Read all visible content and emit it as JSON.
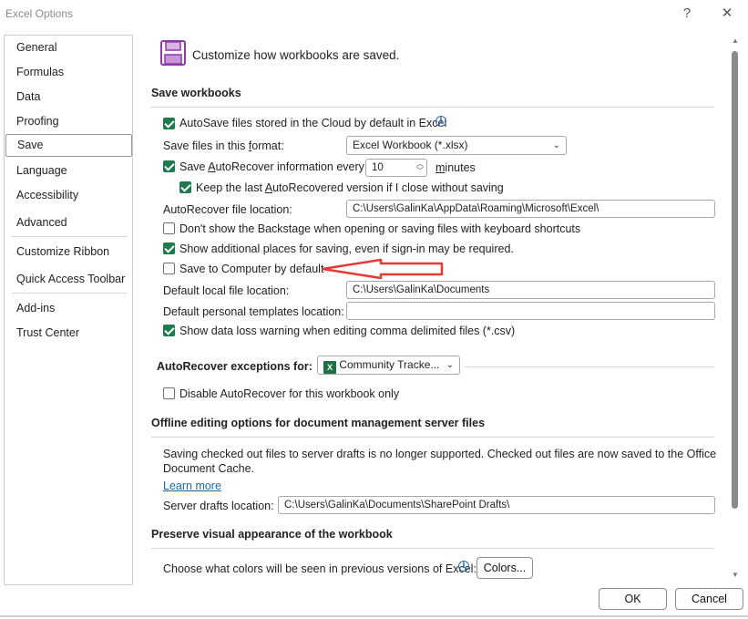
{
  "window": {
    "title": "Excel Options",
    "help_label": "?",
    "close_label": "✕"
  },
  "sidebar": {
    "items": [
      {
        "label": "General"
      },
      {
        "label": "Formulas"
      },
      {
        "label": "Data"
      },
      {
        "label": "Proofing"
      },
      {
        "label": "Save"
      },
      {
        "label": "Language"
      },
      {
        "label": "Accessibility"
      },
      {
        "label": "Advanced"
      },
      {
        "label": "Customize Ribbon"
      },
      {
        "label": "Quick Access Toolbar"
      },
      {
        "label": "Add-ins"
      },
      {
        "label": "Trust Center"
      }
    ],
    "selected": "Save"
  },
  "header": {
    "icon": "save-floppy-icon",
    "title": "Customize how workbooks are saved."
  },
  "save_workbooks": {
    "heading": "Save workbooks",
    "autosave_label": "AutoSave files stored in the Cloud by default in Excel",
    "autosave_checked": true,
    "format_label_pre": "Save files in this ",
    "format_label_u": "f",
    "format_label_post": "ormat:",
    "format_value": "Excel Workbook (*.xlsx)",
    "autorecover_pre": "Save ",
    "autorecover_u": "A",
    "autorecover_post": "utoRecover information every",
    "autorecover_checked": true,
    "autorecover_minutes": "10",
    "minutes_u": "m",
    "minutes_post": "inutes",
    "keep_pre": "Keep the last ",
    "keep_u": "A",
    "keep_post": "utoRecovered version if I close without saving",
    "keep_checked": true,
    "ar_location_pre": "AutoRecover file location:",
    "ar_location_value": "C:\\Users\\GalinKa\\AppData\\Roaming\\Microsoft\\Excel\\",
    "backstage_label": "Don't show the Backstage when opening or saving files with keyboard shortcuts",
    "backstage_checked": false,
    "additional_places_label": "Show additional places for saving, even if sign-in may be required.",
    "additional_places_checked": true,
    "save_computer_label": "Save to Computer by default",
    "save_computer_checked": false,
    "default_local_label": "Default local file location:",
    "default_local_value": "C:\\Users\\GalinKa\\Documents",
    "templates_label": "Default personal templates location:",
    "templates_value": "",
    "csv_warning_label": "Show data loss warning when editing comma delimited files (*.csv)",
    "csv_warning_checked": true
  },
  "exceptions": {
    "label": "AutoRecover exceptions for:",
    "workbook": "Community Tracke...",
    "workbook_icon": "excel-icon",
    "disable_label": "Disable AutoRecover for this workbook only",
    "disable_checked": false
  },
  "offline": {
    "heading": "Offline editing options for document management server files",
    "notice_line1": "Saving checked out files to server drafts is no longer supported. Checked out files are now saved to the Office",
    "notice_line2": "Document Cache.",
    "learn_more": "Learn more",
    "drafts_label": "Server drafts location:",
    "drafts_value": "C:\\Users\\GalinKa\\Documents\\SharePoint Drafts\\"
  },
  "visual": {
    "heading": "Preserve visual appearance of the workbook",
    "colors_label": "Choose what colors will be seen in previous versions of Excel:",
    "colors_button": "Colors..."
  },
  "footer": {
    "ok": "OK",
    "cancel": "Cancel"
  },
  "colors": {
    "accent_green": "#1f7a4d",
    "annotation_red": "#e53935",
    "link_blue": "#1b6a9e"
  }
}
